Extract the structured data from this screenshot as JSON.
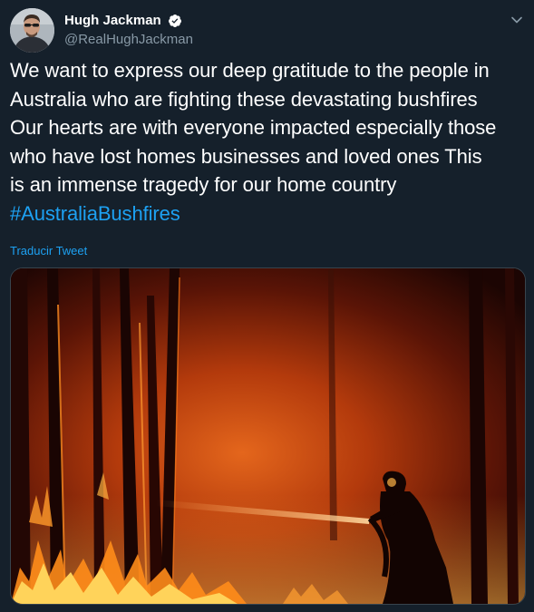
{
  "author": {
    "display_name": "Hugh Jackman",
    "handle": "@RealHughJackman",
    "verified": true,
    "avatar_icon": "profile-photo"
  },
  "tweet": {
    "lines": [
      "We want to express our deep gratitude to the people in",
      "Australia who are fighting these devastating bushfires",
      "Our hearts are with everyone impacted especially those",
      "who have lost homes businesses and loved ones This",
      "is an immense tragedy for our home country"
    ],
    "hashtag": "#AustraliaBushfires"
  },
  "translate_label": "Traducir Tweet",
  "media": {
    "icon": "bushfire-firefighter-photo"
  },
  "colors": {
    "background": "#15202b",
    "text": "#ffffff",
    "secondary": "#8899a6",
    "accent": "#1da1f2",
    "border": "#38444d"
  }
}
